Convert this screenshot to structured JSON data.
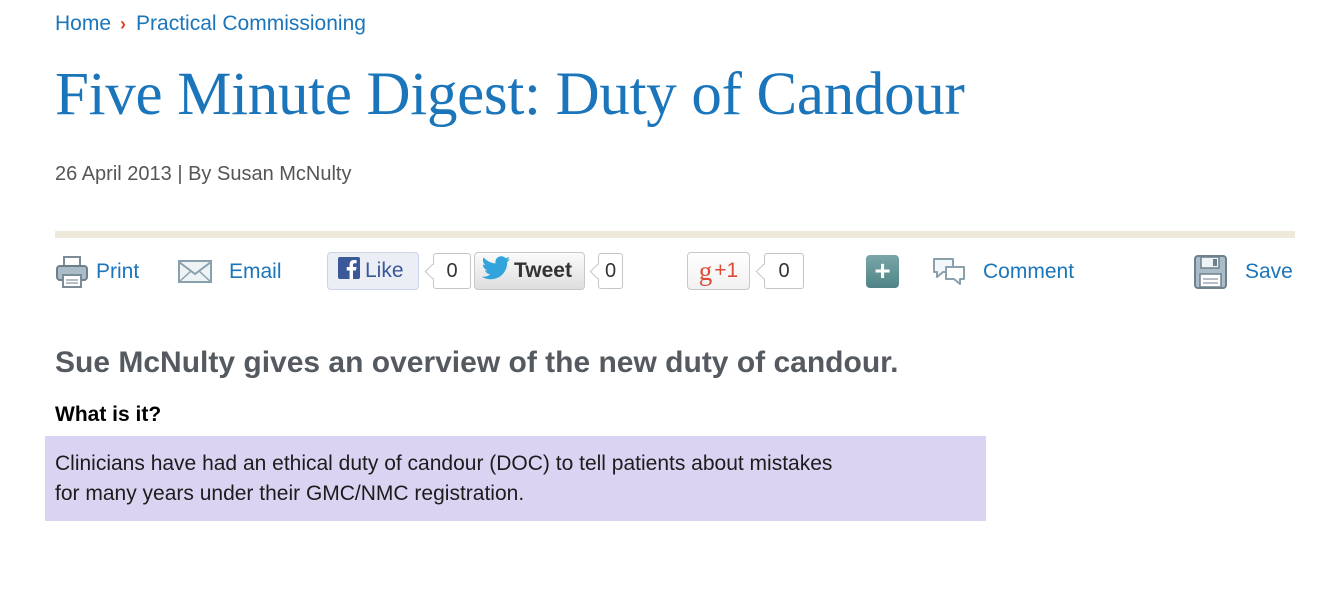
{
  "breadcrumb": {
    "home": "Home",
    "separator": "›",
    "section": "Practical Commissioning"
  },
  "article": {
    "title": "Five Minute Digest: Duty of Candour",
    "date": "26 April 2013",
    "meta_separator": "|",
    "byline": "By Susan McNulty",
    "standfirst": "Sue McNulty gives an overview of the new duty of candour.",
    "section_heading": "What is it?",
    "callout_line1": "Clinicians have had an ethical duty of candour (DOC) to tell patients about mistakes",
    "callout_line2": "for many years under their GMC/NMC registration."
  },
  "toolbar": {
    "print_label": "Print",
    "email_label": "Email",
    "like_label": "Like",
    "like_count": "0",
    "tweet_label": "Tweet",
    "tweet_count": "0",
    "gplus_label": "+1",
    "gplus_count": "0",
    "comment_label": "Comment",
    "save_label": "Save",
    "icons": [
      "printer-icon",
      "envelope-icon",
      "facebook-icon",
      "twitter-bird-icon",
      "google-g-icon",
      "plus-icon",
      "speech-bubbles-icon",
      "floppy-disk-icon"
    ]
  },
  "colors": {
    "link": "#1a75bb",
    "breadcrumb_separator": "#e0452a",
    "rule": "#efe9dc",
    "callout_bg": "#dbd3f2",
    "subtitle": "#555a60"
  }
}
